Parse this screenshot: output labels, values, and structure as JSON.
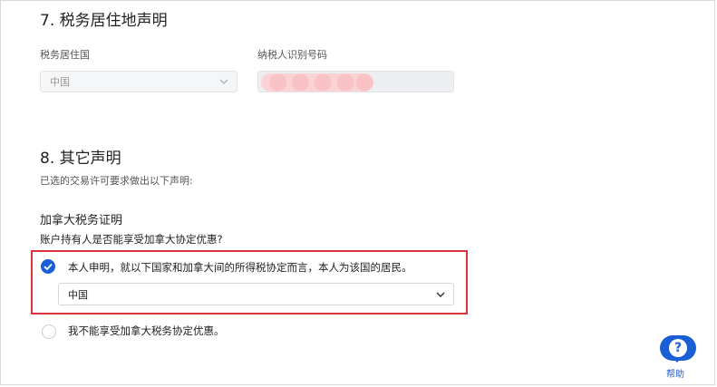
{
  "section7": {
    "title": "7. 税务居住地声明",
    "residence_country_label": "税务居住国",
    "residence_country_value": "中国",
    "tin_label": "纳税人识别号码"
  },
  "section8": {
    "title": "8. 其它声明",
    "subtitle": "已选的交易许可要求做出以下声明:",
    "canada_heading": "加拿大税务证明",
    "question": "账户持有人是否能享受加拿大协定优惠?",
    "option_yes": "本人申明，就以下国家和加拿大间的所得税协定而言，本人为该国的居民。",
    "option_yes_country": "中国",
    "option_no": "我不能享受加拿大税务协定优惠。"
  },
  "help": {
    "icon_glyph": "?",
    "label": "帮助"
  },
  "colors": {
    "accent": "#1b5fd6",
    "highlight": "#e0323c",
    "redaction": "#fbd3d5"
  }
}
